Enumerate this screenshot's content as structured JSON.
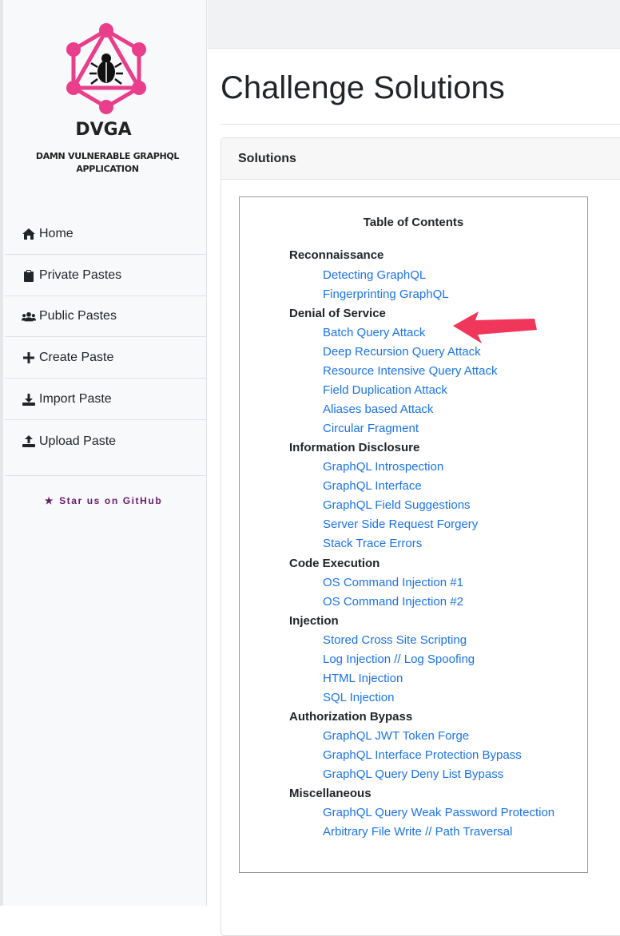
{
  "brand": {
    "title": "DVGA",
    "subtitle": "DAMN VULNERABLE GRAPHQL APPLICATION",
    "accent_color": "#e83e8c"
  },
  "sidebar": {
    "items": [
      {
        "label": "Home",
        "icon": "home-icon"
      },
      {
        "label": "Private Pastes",
        "icon": "clipboard-icon"
      },
      {
        "label": "Public Pastes",
        "icon": "users-icon"
      },
      {
        "label": "Create Paste",
        "icon": "plus-icon"
      },
      {
        "label": "Import Paste",
        "icon": "download-icon"
      },
      {
        "label": "Upload Paste",
        "icon": "upload-icon"
      }
    ],
    "star_label": "Star us on GitHub"
  },
  "page": {
    "title": "Challenge Solutions",
    "card_header": "Solutions"
  },
  "toc": {
    "heading": "Table of Contents",
    "sections": [
      {
        "title": "Reconnaissance",
        "links": [
          "Detecting GraphQL",
          "Fingerprinting GraphQL"
        ]
      },
      {
        "title": "Denial of Service",
        "links": [
          "Batch Query Attack",
          "Deep Recursion Query Attack",
          "Resource Intensive Query Attack",
          "Field Duplication Attack",
          "Aliases based Attack",
          "Circular Fragment"
        ]
      },
      {
        "title": "Information Disclosure",
        "links": [
          "GraphQL Introspection",
          "GraphQL Interface",
          "GraphQL Field Suggestions",
          "Server Side Request Forgery",
          "Stack Trace Errors"
        ]
      },
      {
        "title": "Code Execution",
        "links": [
          "OS Command Injection #1",
          "OS Command Injection #2"
        ]
      },
      {
        "title": "Injection",
        "links": [
          "Stored Cross Site Scripting",
          "Log Injection // Log Spoofing",
          "HTML Injection",
          "SQL Injection"
        ]
      },
      {
        "title": "Authorization Bypass",
        "links": [
          "GraphQL JWT Token Forge",
          "GraphQL Interface Protection Bypass",
          "GraphQL Query Deny List Bypass"
        ]
      },
      {
        "title": "Miscellaneous",
        "links": [
          "GraphQL Query Weak Password Protection",
          "Arbitrary File Write // Path Traversal"
        ]
      }
    ]
  },
  "annotation": {
    "arrow_color": "#f0365a",
    "points_to": "Batch Query Attack"
  }
}
